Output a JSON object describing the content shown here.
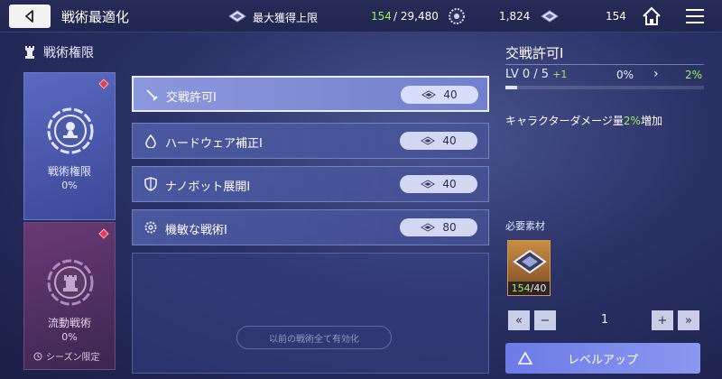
{
  "topbar": {
    "title": "戦術最適化",
    "max_label": "最大獲得上限",
    "max_current": "154",
    "max_total": "/ 29,480",
    "currency1": "1,824",
    "currency2": "154"
  },
  "section": {
    "title": "戦術権限"
  },
  "categories": [
    {
      "label": "戦術権限",
      "percent": "0%"
    },
    {
      "label": "流動戦術",
      "percent": "0%",
      "note": "シーズン限定"
    }
  ],
  "rows": [
    {
      "label": "交戦許可Ⅰ",
      "cost": "40",
      "icon": "sword-icon"
    },
    {
      "label": "ハードウェア補正Ⅰ",
      "cost": "40",
      "icon": "droplet-icon"
    },
    {
      "label": "ナノボット展開Ⅰ",
      "cost": "40",
      "icon": "shield-icon"
    },
    {
      "label": "機敏な戦術Ⅰ",
      "cost": "80",
      "icon": "gear-icon"
    }
  ],
  "list": {
    "enable_all": "以前の戦術全て有効化"
  },
  "detail": {
    "title": "交戦許可Ⅰ",
    "lv_prefix": "LV",
    "lv_current": "0",
    "lv_max": "/ 5",
    "lv_plus": "+1",
    "pct_current": "0%",
    "arrow": "›",
    "pct_next": "2%",
    "progress": 0.06,
    "desc_pre": "キャラクターダメージ量",
    "desc_val": "2%",
    "desc_post": "増加"
  },
  "materials": {
    "label": "必要素材",
    "count_have": "154",
    "count_need": "/40"
  },
  "quantity": {
    "value": "1"
  },
  "levelup": {
    "label": "レベルアップ"
  },
  "colors": {
    "accent_green": "#9df25b",
    "alert_red": "#e33c4e"
  }
}
